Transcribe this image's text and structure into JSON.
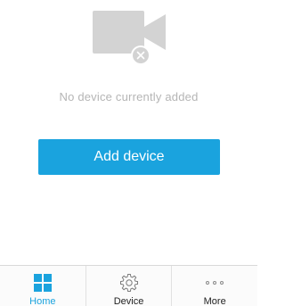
{
  "empty_state": {
    "icon": "video-camera-icon",
    "badge_icon": "close-icon",
    "message": "No device currently added"
  },
  "actions": {
    "add_device_label": "Add device"
  },
  "tabbar": {
    "items": [
      {
        "label": "Home",
        "icon": "grid-icon",
        "active": true
      },
      {
        "label": "Device",
        "icon": "gear-icon",
        "active": false
      },
      {
        "label": "More",
        "icon": "more-dots-icon",
        "active": false
      }
    ]
  },
  "colors": {
    "accent": "#1aa3de",
    "camera_gray": "#d3d3d3",
    "muted_text": "#b5b5b5"
  }
}
